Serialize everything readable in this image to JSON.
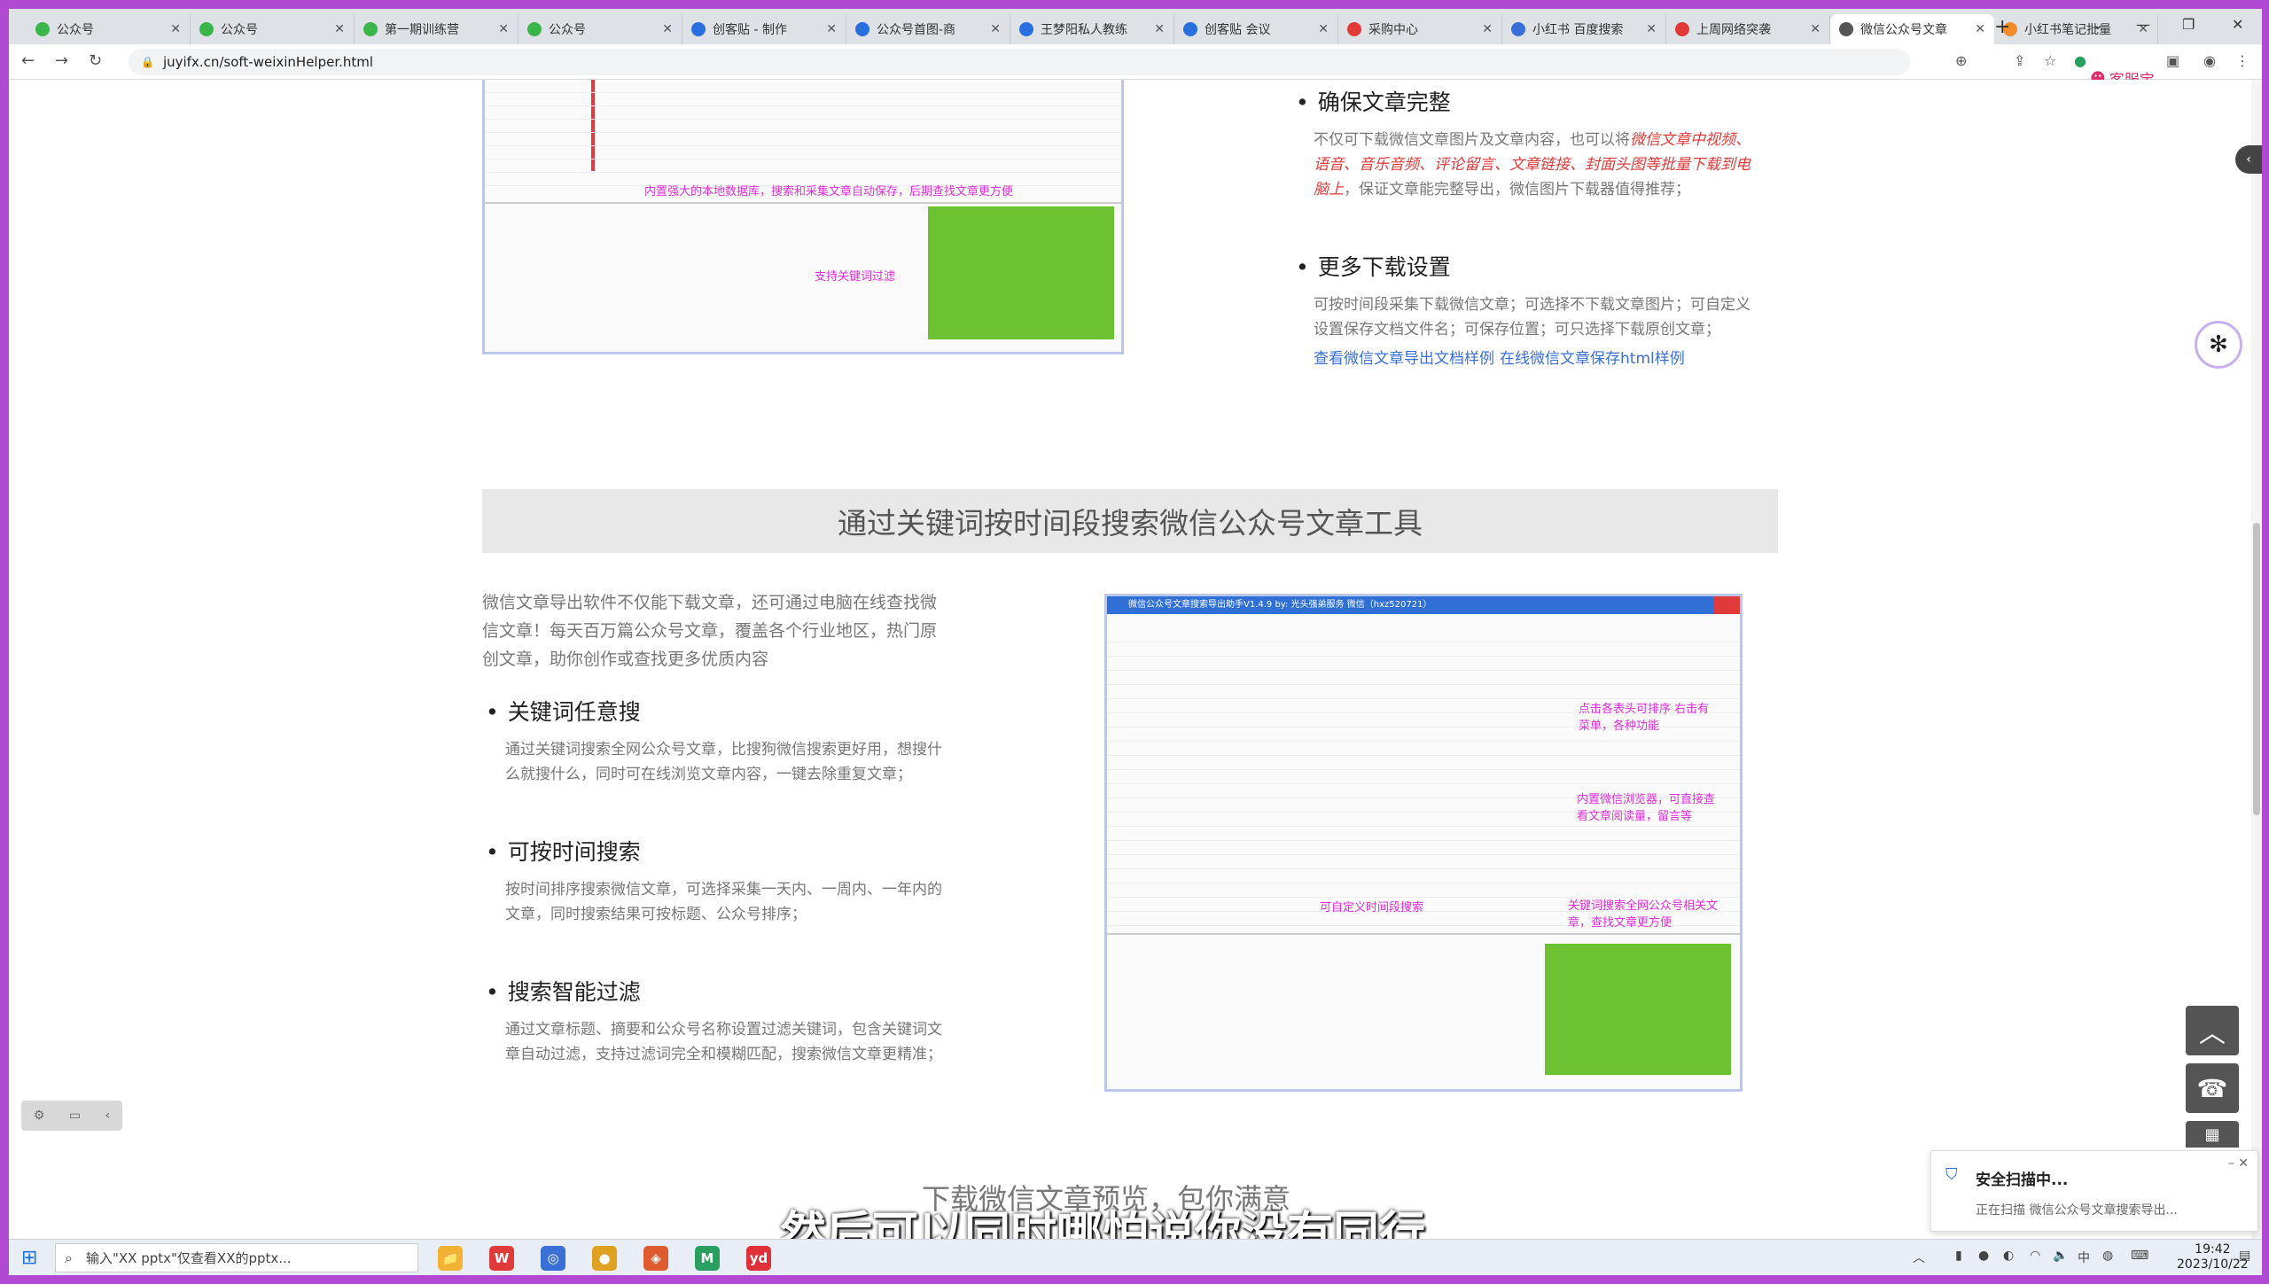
{
  "browser": {
    "tabs": [
      {
        "title": "公众号",
        "color": "#3ab54a"
      },
      {
        "title": "公众号",
        "color": "#3ab54a"
      },
      {
        "title": "第一期训练营",
        "color": "#3ab54a"
      },
      {
        "title": "公众号",
        "color": "#3ab54a"
      },
      {
        "title": "创客贴 - 制作",
        "color": "#2a6fe0"
      },
      {
        "title": "公众号首图-商",
        "color": "#2a6fe0"
      },
      {
        "title": "王梦阳私人教练",
        "color": "#2a6fe0"
      },
      {
        "title": "创客贴 会议",
        "color": "#2a6fe0"
      },
      {
        "title": "采购中心",
        "color": "#e03a3a"
      },
      {
        "title": "小红书 百度搜索",
        "color": "#3a6fd8"
      },
      {
        "title": "上周网络突袭",
        "color": "#e03a3a"
      },
      {
        "title": "微信公众号文章",
        "color": "#555555"
      },
      {
        "title": "小红书笔记批量",
        "color": "#f28c28"
      }
    ],
    "active_tab_index": 11,
    "url": "juyifx.cn/soft-weixinHelper.html",
    "kefu_label": "客服宝"
  },
  "page": {
    "top_right_section": {
      "title1": "确保文章完整",
      "para1_prefix": "不仅可下载微信文章图片及文章内容，也可以将",
      "para1_highlight": "微信文章中视频、语音、音乐音频、评论留言、文章链接、封面头图等批量下载到电脑上",
      "para1_suffix": "，保证文章能完整导出，微信图片下载器值得推荐；",
      "title2": "更多下载设置",
      "para2": "可按时间段采集下载微信文章；可选择不下载文章图片；可自定义设置保存文档文件名；可保存位置；可只选择下载原创文章；",
      "link1": "查看微信文章导出文档样例",
      "link2": "在线微信文章保存html样例"
    },
    "top_left_shot": {
      "annot1": "内置强大的本地数据库，搜索和采集文章自动保存，后期查找文章更方便",
      "annot2": "支持关键词过滤"
    },
    "section_heading": "通过关键词按时间段搜索微信公众号文章工具",
    "intro": "微信文章导出软件不仅能下载文章，还可通过电脑在线查找微信文章！每天百万篇公众号文章，覆盖各个行业地区，热门原创文章，助你创作或查找更多优质内容",
    "features": [
      {
        "title": "关键词任意搜",
        "desc": "通过关键词搜索全网公众号文章，比搜狗微信搜索更好用，想搜什么就搜什么，同时可在线浏览文章内容，一键去除重复文章；"
      },
      {
        "title": "可按时间搜索",
        "desc": "按时间排序搜索微信文章，可选择采集一天内、一周内、一年内的文章，同时搜索结果可按标题、公众号排序；"
      },
      {
        "title": "搜索智能过滤",
        "desc": "通过文章标题、摘要和公众号名称设置过滤关键词，包含关键词文章自动过滤，支持过滤词完全和模糊匹配，搜索微信文章更精准；"
      }
    ],
    "right_shot": {
      "window_title": "微信公众号文章搜索导出助手V1.4.9  by:  光头强弟服务  微信（hxz520721）",
      "annot1": "点击各表头可排序 右击有菜单，各种功能",
      "annot2": "内置微信浏览器，可直接查看文章阅读量，留言等",
      "annot3": "可自定义时间段搜索",
      "annot4": "关键词搜索全网公众号相关文章，查找文章更方便"
    },
    "footer_heading": "下载微信文章预览，包你满意"
  },
  "toast": {
    "title": "安全扫描中...",
    "body": "正在扫描 微信公众号文章搜索导出..."
  },
  "subtitle": "然后可以同时哪怕说你没有同行",
  "taskbar": {
    "search_placeholder": "输入\"XX pptx\"仅查看XX的pptx...",
    "time": "19:42",
    "date": "2023/10/22",
    "apps": [
      {
        "label": "📁",
        "color": "#f2b233"
      },
      {
        "label": "W",
        "color": "#e03a3a"
      },
      {
        "label": "◎",
        "color": "#3a6fd8"
      },
      {
        "label": "●",
        "color": "#e0a020"
      },
      {
        "label": "◈",
        "color": "#e05a30"
      },
      {
        "label": "M",
        "color": "#2aa060"
      },
      {
        "label": "yd",
        "color": "#e0303a"
      }
    ]
  }
}
